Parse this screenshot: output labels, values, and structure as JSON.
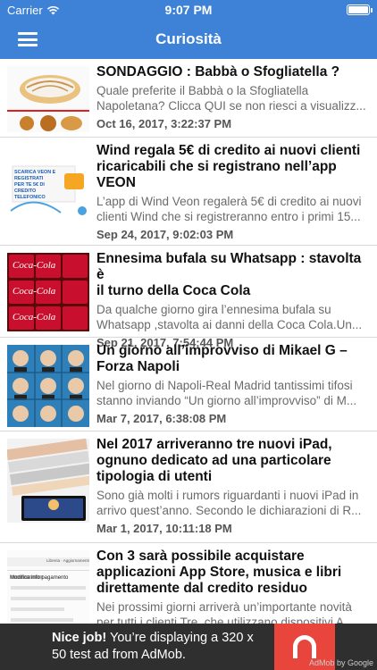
{
  "status_bar": {
    "carrier": "Carrier",
    "time": "9:07 PM"
  },
  "nav": {
    "title": "Curiosità"
  },
  "articles": [
    {
      "title_lines": [
        "SONDAGGIO : Babbà o Sfogliatella ?"
      ],
      "excerpt_lines": [
        "Quale preferite il Babbà o la Sfogliatella",
        "Napoletana? Clicca QUI se non riesci a visualizz..."
      ],
      "date": "Oct 16, 2017, 3:22:37 PM"
    },
    {
      "title_lines": [
        "Wind regala 5€ di credito ai nuovi clienti",
        "ricaricabili che si registrano nell’app",
        "VEON"
      ],
      "excerpt_lines": [
        "L’app di Wind Veon regalerà 5€ di credito ai nuovi",
        "clienti Wind che si registreranno entro i primi 15..."
      ],
      "date": "Sep 24, 2017, 9:02:03 PM"
    },
    {
      "title_lines": [
        "Ennesima bufala su Whatsapp : stavolta è",
        "il turno della Coca Cola"
      ],
      "excerpt_lines": [
        "Da qualche giorno gira l’ennesima bufala su",
        "Whatsapp ,stavolta ai danni della Coca Cola.Un..."
      ],
      "date": "Sep 21, 2017, 7:54:44 PM"
    },
    {
      "title_lines": [
        "Un giorno all’improvviso di Mikael G –",
        "Forza Napoli"
      ],
      "excerpt_lines": [
        "Nel giorno di Napoli-Real Madrid tantissimi tifosi",
        "stanno inviando “Un giorno all’improvviso” di M..."
      ],
      "date": "Mar 7, 2017, 6:38:08 PM"
    },
    {
      "title_lines": [
        "Nel 2017 arriveranno tre nuovi iPad,",
        "ognuno dedicato ad una particolare",
        "tipologia di utenti"
      ],
      "excerpt_lines": [
        "Sono già molti i rumors riguardanti i nuovi iPad in",
        "arrivo quest’anno. Secondo le dichiarazioni di R..."
      ],
      "date": "Mar 1, 2017, 10:11:18 PM"
    },
    {
      "title_lines": [
        "Con 3 sarà possibile acquistare",
        "applicazioni App Store, musica e libri",
        "direttamente dal credito residuo"
      ],
      "excerpt_lines": [
        "Nei prossimi giorni arriverà un’importante novità",
        "per tutti i clienti Tre, che utilizzano dispositivi A..."
      ],
      "date": ""
    }
  ],
  "thumb_texts": {
    "wind": [
      "SCARICA VEON E REGISTRATI",
      "PER TE 5€ DI CREDITO",
      "TELEFONICO"
    ],
    "coca": "Coca-Cola",
    "app_store": [
      "Modifica info pagamento",
      "Libreria · Aggiornamenti"
    ]
  },
  "ad": {
    "headline": "Nice job!",
    "body": " You’re displaying a 320 x 50 test ad from AdMob.",
    "badge": "AdMob by Google"
  },
  "colors": {
    "header": "#3d82d6",
    "ad_background": "#2f2f2f",
    "ad_accent": "#e8453c"
  }
}
